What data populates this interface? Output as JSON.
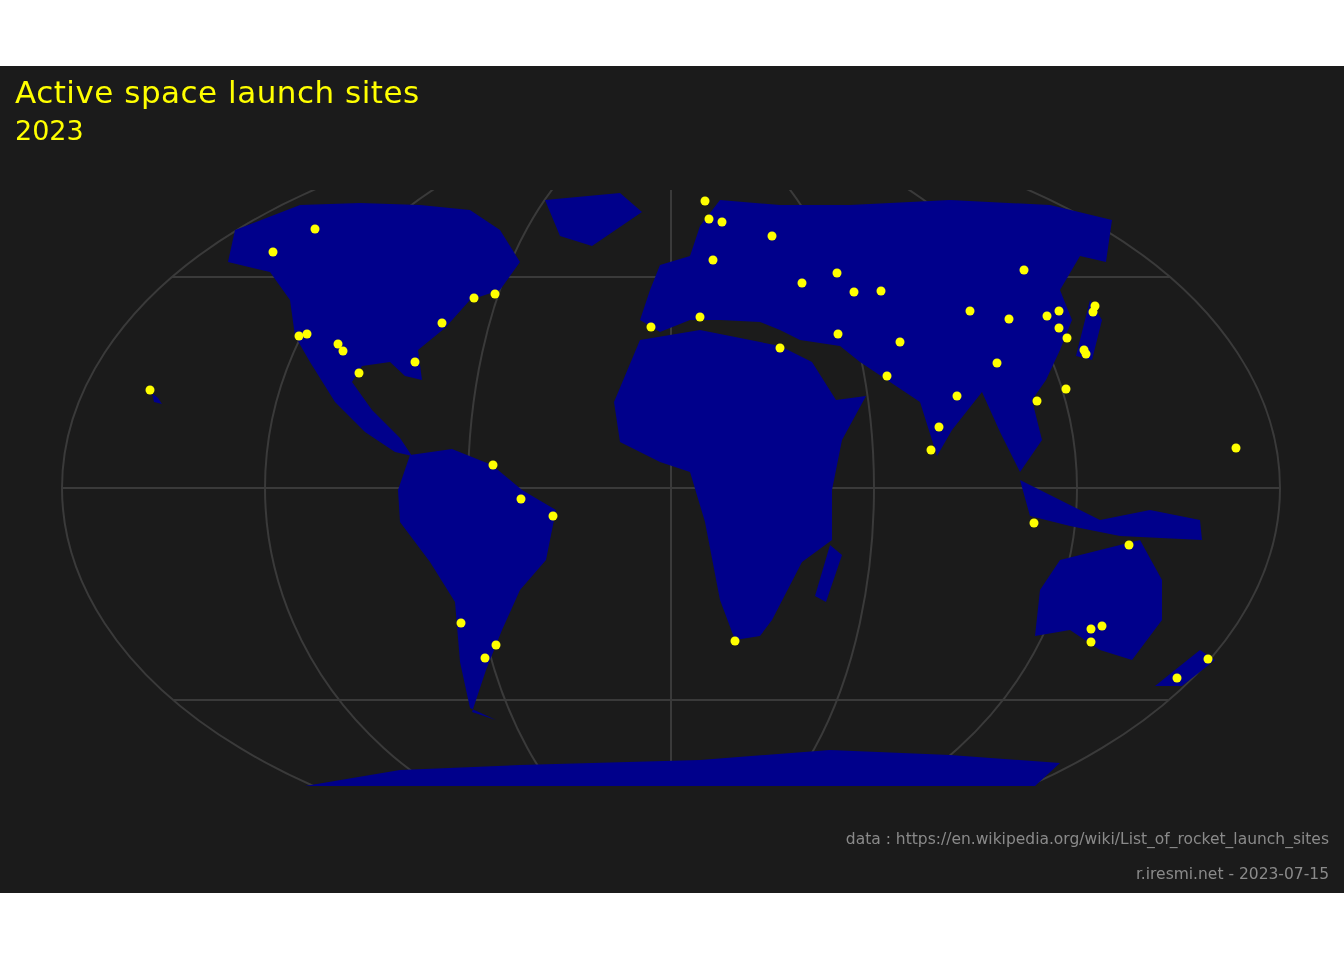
{
  "title": "Active space launch sites",
  "subtitle": "2023",
  "source_caption": "data : https://en.wikipedia.org/wiki/List_of_rocket_launch_sites",
  "credit_caption": "r.iresmi.net - 2023-07-15"
}
